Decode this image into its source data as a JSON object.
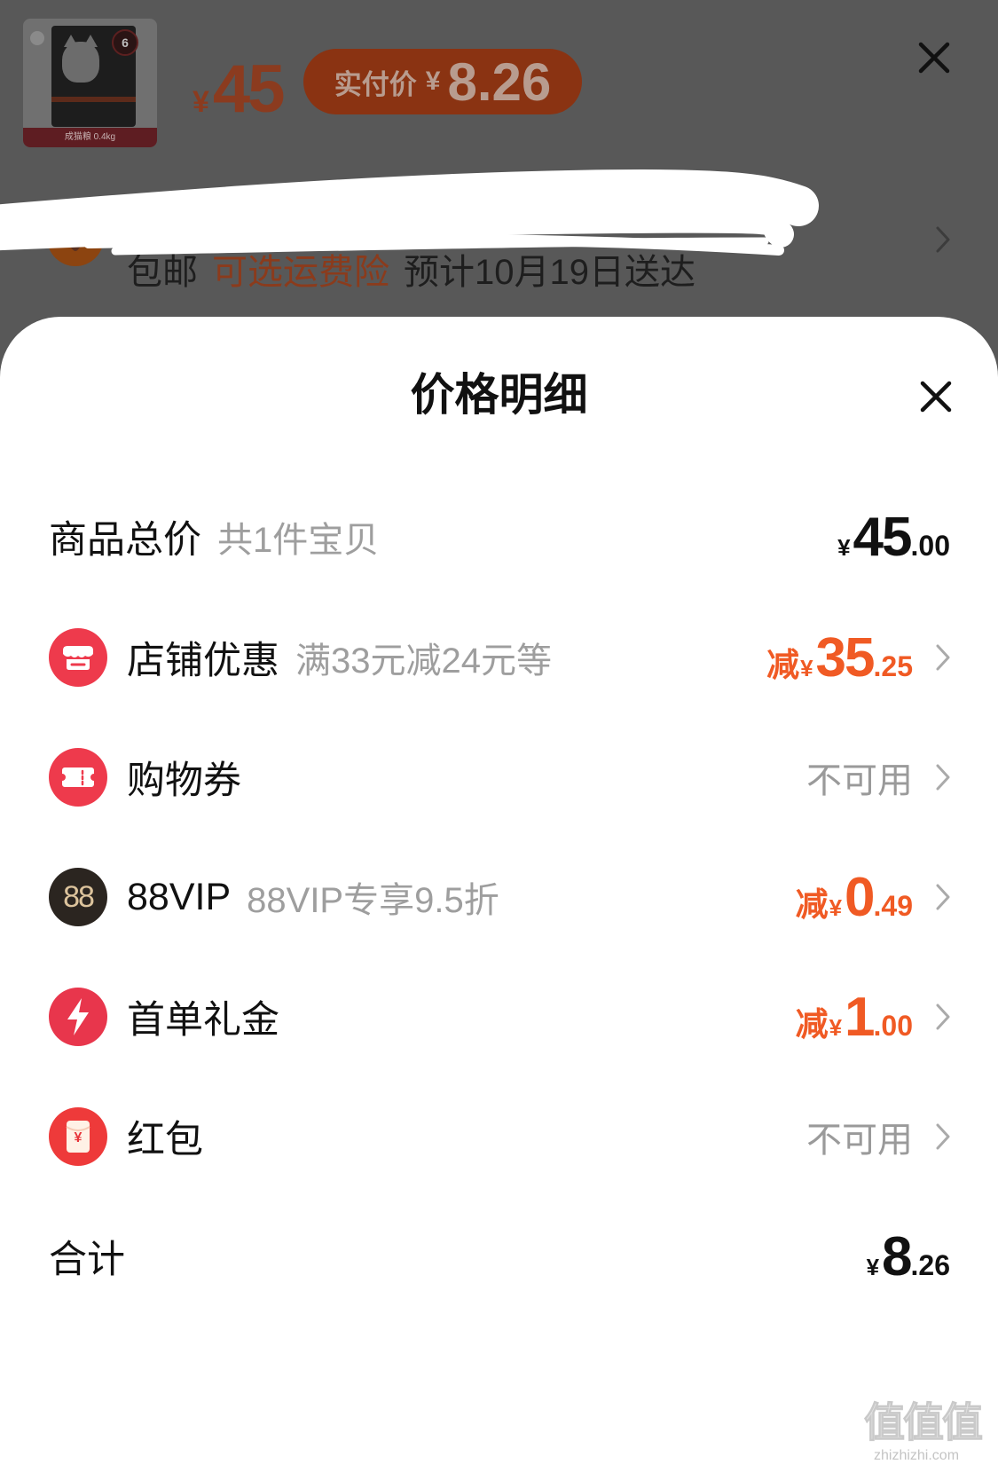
{
  "background": {
    "product_thumbnail": {
      "badge": "6",
      "band_text": "成猫粮 0.4kg"
    },
    "price": {
      "currency": "¥",
      "amount": "45"
    },
    "paid_pill": {
      "label": "实付价",
      "currency": "¥",
      "amount": "8.26"
    },
    "shipping": {
      "free": "包邮",
      "insurance": "可选运费险",
      "eta": "预计10月19日送达"
    },
    "icons": [
      "close-icon",
      "delivery-badge-icon",
      "chevron-right-icon"
    ]
  },
  "sheet": {
    "title": "价格明细",
    "close_icon": "close-icon",
    "rows": [
      {
        "label": "商品总价",
        "sub": "共1件宝贝",
        "value": {
          "currency": "¥",
          "int": "45",
          "dec": ".00"
        }
      },
      {
        "icon": "store-icon",
        "label": "店铺优惠",
        "sub": "满33元减24元等",
        "value": {
          "prefix": "减",
          "currency": "¥",
          "int": "35",
          "dec": ".25"
        }
      },
      {
        "icon": "ticket-icon",
        "label": "购物券",
        "status": "不可用"
      },
      {
        "icon": "88vip-icon",
        "icon_text": "88",
        "label": "88VIP",
        "sub": "88VIP专享9.5折",
        "value": {
          "prefix": "减",
          "currency": "¥",
          "int": "0",
          "dec": ".49"
        }
      },
      {
        "icon": "lightning-icon",
        "label": "首单礼金",
        "value": {
          "prefix": "减",
          "currency": "¥",
          "int": "1",
          "dec": ".00"
        }
      },
      {
        "icon": "red-envelope-icon",
        "icon_text": "¥",
        "label": "红包",
        "status": "不可用"
      }
    ],
    "total": {
      "label": "合计",
      "value": {
        "currency": "¥",
        "int": "8",
        "dec": ".26"
      }
    }
  },
  "watermark": {
    "logo": "值值值",
    "site": "zhizhizhi.com"
  },
  "colors": {
    "accent_orange": "#f05a24",
    "icon_red": "#ee3a4c",
    "vip_dark": "#2b2520",
    "vip_gold": "#dcc39c",
    "muted_text": "#9e9e9e",
    "overlay": "#585858"
  }
}
